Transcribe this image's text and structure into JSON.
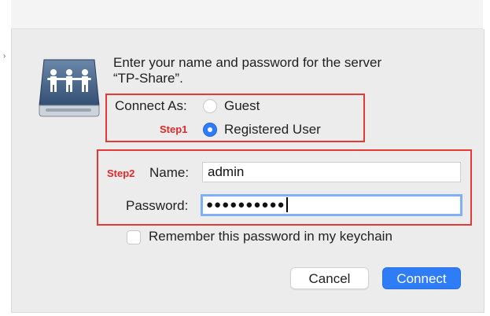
{
  "window": {
    "background": "#ececec"
  },
  "dialog": {
    "prompt_line1": "Enter your name and password for the server",
    "prompt_line2": "“TP-Share”."
  },
  "connect_as": {
    "label": "Connect As:",
    "options": [
      {
        "label": "Guest",
        "selected": false
      },
      {
        "label": "Registered User",
        "selected": true
      }
    ]
  },
  "annotations": {
    "step1": "Step1",
    "step2": "Step2",
    "color": "#e53935"
  },
  "credentials": {
    "name_label": "Name:",
    "name_value": "admin",
    "password_label": "Password:",
    "password_masked": "●●●●●●●●●●"
  },
  "keychain": {
    "label": "Remember this password in my keychain",
    "checked": false
  },
  "buttons": {
    "cancel": "Cancel",
    "connect": "Connect",
    "accent": "#2f7df6"
  },
  "icons": {
    "server": "shared-server-icon"
  }
}
